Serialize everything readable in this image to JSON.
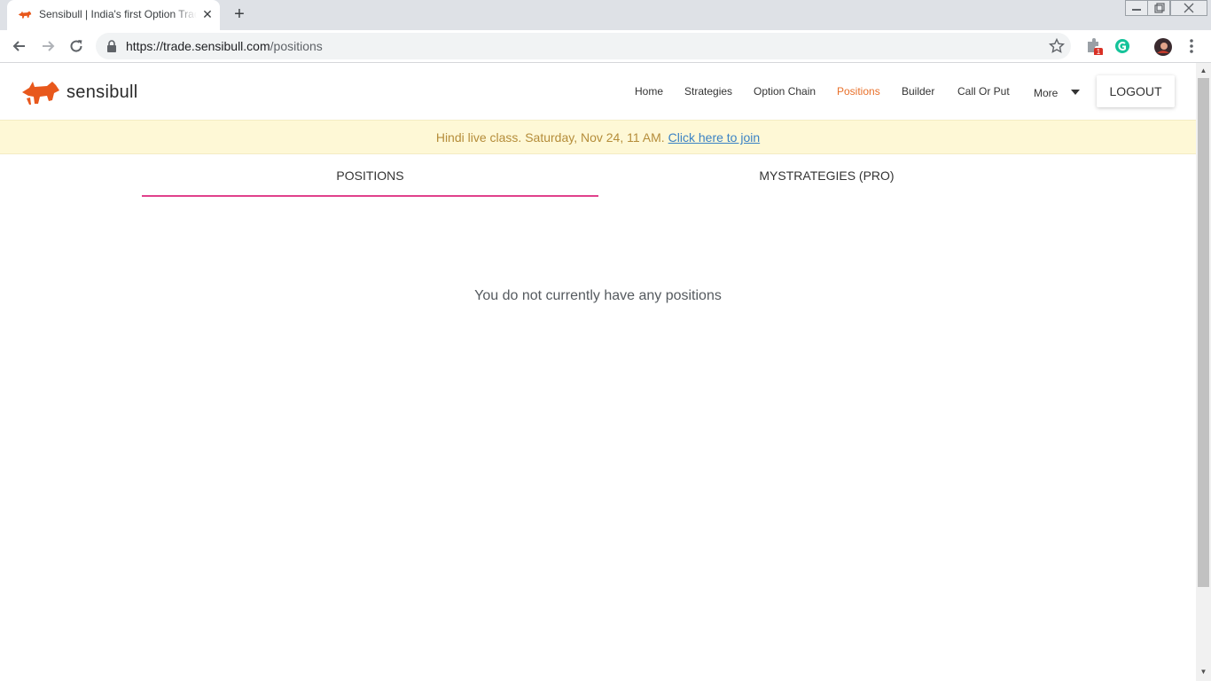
{
  "browser": {
    "tab_title": "Sensibull | India's first Option Trading Platform",
    "url_host": "https://trade.sensibull.com",
    "url_path": "/positions",
    "extension_badge": "1"
  },
  "header": {
    "brand": "sensibull",
    "nav": {
      "home": "Home",
      "strategies": "Strategies",
      "option_chain": "Option Chain",
      "positions": "Positions",
      "builder": "Builder",
      "call_or_put": "Call Or Put",
      "more": "More"
    },
    "logout_label": "LOGOUT",
    "accent_color": "#e8702a"
  },
  "banner": {
    "text": "Hindi live class. Saturday, Nov 24, 11 AM.",
    "link": "Click here to join"
  },
  "tabs": {
    "positions": "POSITIONS",
    "mystrategies": "MYSTRATEGIES (PRO)"
  },
  "empty_state": {
    "message": "You do not currently have any positions"
  }
}
